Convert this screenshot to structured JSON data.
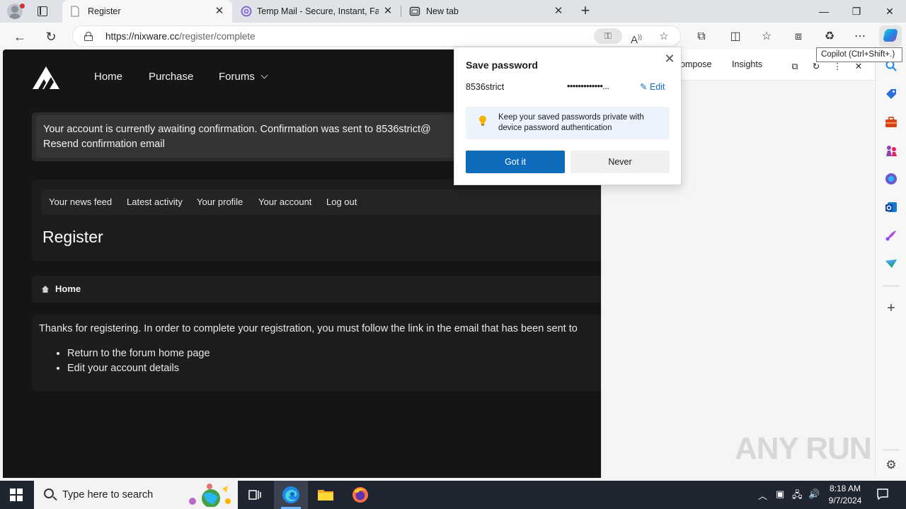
{
  "browser": {
    "tabs": [
      {
        "title": "Register",
        "active": true
      },
      {
        "title": "Temp Mail - Secure, Instant, Fast",
        "active": false
      },
      {
        "title": "New tab",
        "active": false
      }
    ],
    "address": {
      "host": "https://nixware.cc",
      "path": "/register/complete"
    },
    "copilot_tooltip": "Copilot (Ctrl+Shift+.)"
  },
  "site": {
    "nav": [
      "Home",
      "Purchase",
      "Forums"
    ],
    "notice_line1": "Your account is currently awaiting confirmation. Confirmation was sent to 8536strict@",
    "notice_line2": "Resend confirmation email",
    "subnav": [
      "Your news feed",
      "Latest activity",
      "Your profile",
      "Your account",
      "Log out"
    ],
    "page_title": "Register",
    "breadcrumb": "Home",
    "message": "Thanks for registering. In order to complete your registration, you must follow the link in the email that has been sent to",
    "links": [
      "Return to the forum home page",
      "Edit your account details"
    ]
  },
  "sidepane": {
    "tabs": [
      "ompose",
      "Insights"
    ]
  },
  "save_password": {
    "title": "Save password",
    "username": "8536strict",
    "password_mask": "•••••••••••••...",
    "edit_label": "Edit",
    "tip": "Keep your saved passwords private with device password authentication",
    "primary": "Got it",
    "secondary": "Never"
  },
  "taskbar": {
    "search_placeholder": "Type here to search",
    "time": "8:18 AM",
    "date": "9/7/2024"
  },
  "watermark": "ANY RUN",
  "colors": {
    "accent": "#0f6cbd",
    "page_bg": "#151515",
    "taskbar": "#1f2531"
  }
}
